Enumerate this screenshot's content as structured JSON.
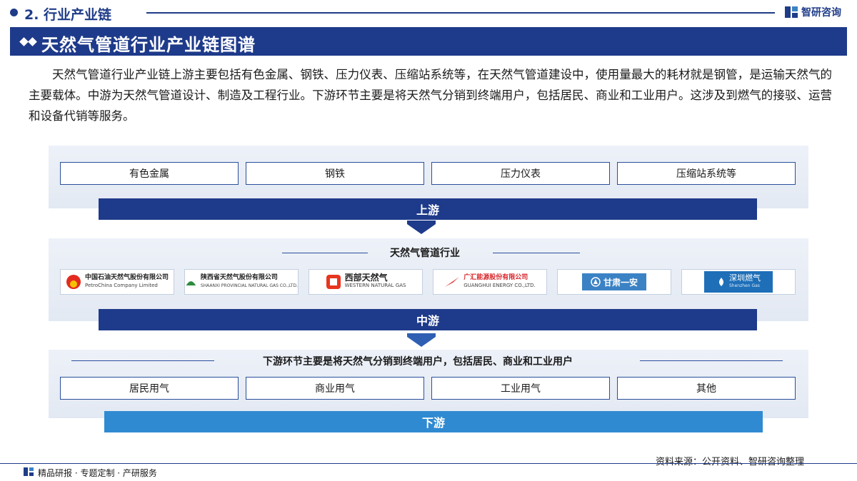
{
  "header": {
    "section_label": "2. 行业产业链",
    "brand_name": "智研咨询"
  },
  "title": "天然气管道行业产业链图谱",
  "intro": "天然气管道行业产业链上游主要包括有色金属、钢铁、压力仪表、压缩站系统等，在天然气管道建设中，使用量最大的耗材就是钢管，是运输天然气的主要载体。中游为天然气管道设计、制造及工程行业。下游环节主要是将天然气分销到终端用户，包括居民、商业和工业用户。这涉及到燃气的接驳、运营和设备代销等服务。",
  "upstream": {
    "items": [
      "有色金属",
      "钢铁",
      "压力仪表",
      "压缩站系统等"
    ],
    "label": "上游"
  },
  "midstream": {
    "heading": "天然气管道行业",
    "logos": [
      {
        "cn": "中国石油天然气股份有限公司",
        "en": "PetroChina Company Limited"
      },
      {
        "cn": "陕西省天然气股份有限公司",
        "en": "SHAANXI PROVINCIAL NATURAL GAS CO.,LTD."
      },
      {
        "cn": "西部天然气",
        "en": "WESTERN NATURAL GAS"
      },
      {
        "cn": "广汇能源股份有限公司",
        "en": "GUANGHUI ENERGY CO.,LTD."
      },
      {
        "cn": "甘肃一安",
        "en": ""
      },
      {
        "cn": "深圳燃气",
        "en": "Shenzhen Gas"
      }
    ],
    "label": "中游"
  },
  "downstream": {
    "heading": "下游环节主要是将天然气分销到终端用户，包括居民、商业和工业用户",
    "items": [
      "居民用气",
      "商业用气",
      "工业用气",
      "其他"
    ],
    "label": "下游"
  },
  "source": "资料来源：公开资料、智研咨询整理",
  "footer": "精品研报 · 专题定制 · 产研服务",
  "colors": {
    "navy": "#1e3a8a",
    "light_blue": "#2f8ad1",
    "panel": "#e8edf6"
  }
}
